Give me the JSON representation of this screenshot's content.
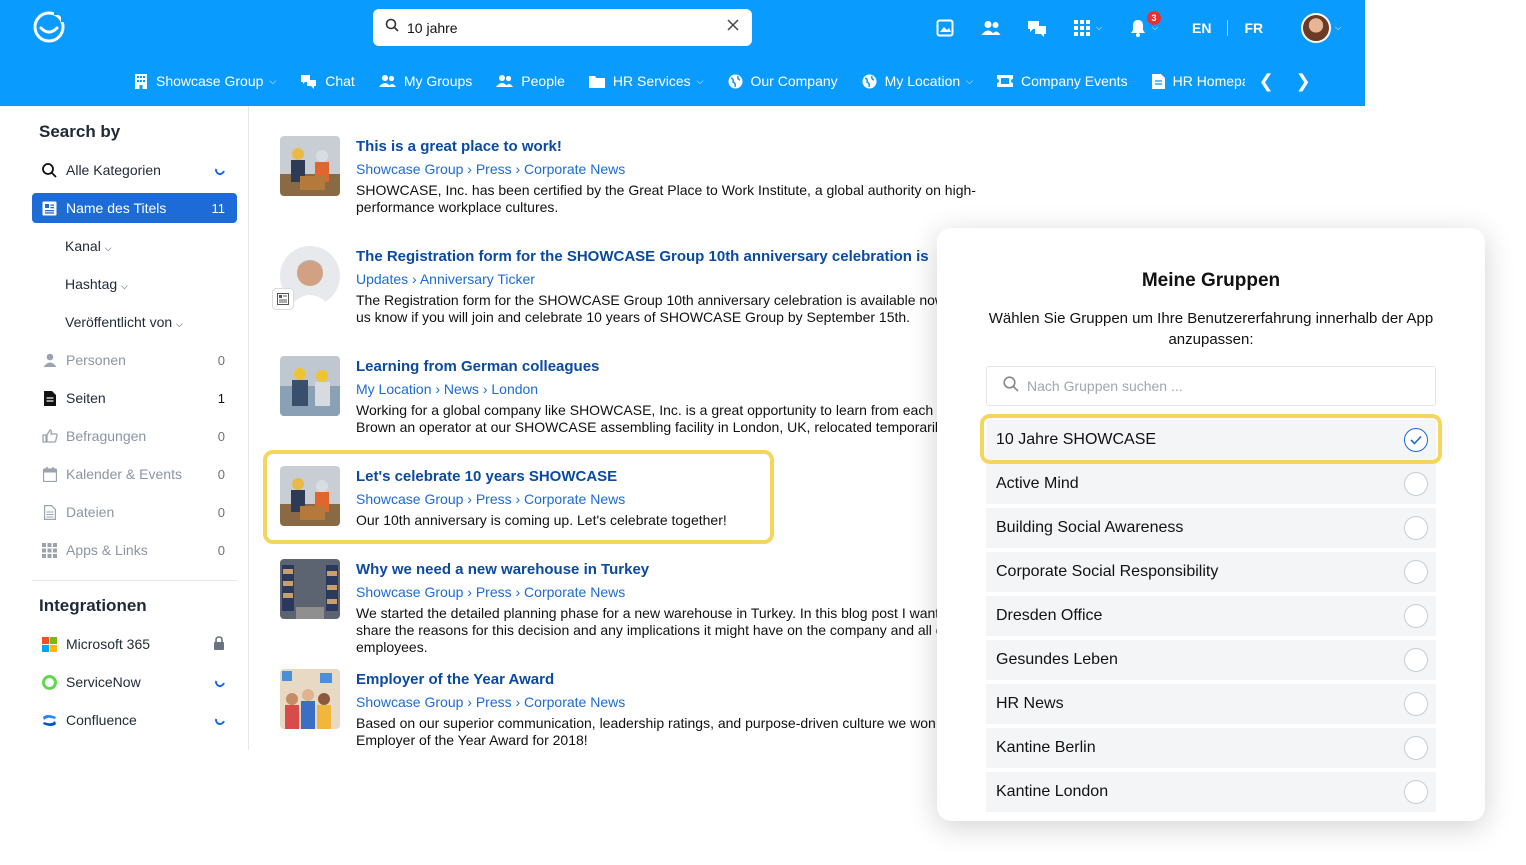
{
  "header": {
    "search_value": "10 jahre",
    "notification_count": "3",
    "languages": [
      "EN",
      "FR"
    ],
    "nav": [
      {
        "label": "Showcase Group",
        "icon": "building-icon",
        "dropdown": true
      },
      {
        "label": "Chat",
        "icon": "chat-icon",
        "dropdown": false
      },
      {
        "label": "My Groups",
        "icon": "users-icon",
        "dropdown": false
      },
      {
        "label": "People",
        "icon": "people-icon",
        "dropdown": false
      },
      {
        "label": "HR Services",
        "icon": "folder-icon",
        "dropdown": true
      },
      {
        "label": "Our Company",
        "icon": "globe-icon",
        "dropdown": false
      },
      {
        "label": "My Location",
        "icon": "globe-icon",
        "dropdown": true
      },
      {
        "label": "Company Events",
        "icon": "ticket-icon",
        "dropdown": false
      },
      {
        "label": "HR Homepage",
        "icon": "page-icon",
        "dropdown": false
      }
    ]
  },
  "sidebar": {
    "search_by_heading": "Search by",
    "categories": [
      {
        "label": "Alle Kategorien",
        "count": ""
      },
      {
        "label": "Name des Titels",
        "count": "11"
      }
    ],
    "filters": [
      "Kanal",
      "Hashtag",
      "Veröffentlicht von"
    ],
    "types": [
      {
        "label": "Personen",
        "count": "0"
      },
      {
        "label": "Seiten",
        "count": "1"
      },
      {
        "label": "Befragungen",
        "count": "0"
      },
      {
        "label": "Kalender & Events",
        "count": "0"
      },
      {
        "label": "Dateien",
        "count": "0"
      },
      {
        "label": "Apps & Links",
        "count": "0"
      }
    ],
    "integrations_heading": "Integrationen",
    "integrations": [
      {
        "label": "Microsoft 365"
      },
      {
        "label": "ServiceNow"
      },
      {
        "label": "Confluence"
      }
    ]
  },
  "results": [
    {
      "title": "This is a great place to work!",
      "crumb": "Showcase Group › Press › Corporate News",
      "snippet": "SHOWCASE, Inc. has been certified by the Great Place to Work Institute, a global authority on high-performance workplace cultures."
    },
    {
      "title": "The Registration form for the SHOWCASE Group 10th anniversary celebration is",
      "crumb": "Updates › Anniversary Ticker",
      "snippet": "The Registration form for the SHOWCASE Group 10th anniversary celebration is available now. Let us know if you will join and celebrate 10 years of SHOWCASE Group by September 15th."
    },
    {
      "title": "Learning from German colleagues",
      "crumb": "My Location › News › London",
      "snippet": "Working for a  global company like SHOWCASE, Inc. is a great opportunity to learn from each other. Brown an operator at our SHOWCASE assembling facility in London, UK, relocated temporarily"
    },
    {
      "title": "Let's celebrate 10 years SHOWCASE",
      "crumb": "Showcase Group › Press › Corporate News",
      "snippet": "Our 10th anniversary is coming up. Let's celebrate together!"
    },
    {
      "title": "Why we need a new warehouse in Turkey",
      "crumb": "Showcase Group › Press › Corporate News",
      "snippet": "We started the detailed planning phase for a new warehouse in Turkey. In this blog post I want to share the reasons for this decision and any implications it might have on the company and all our employees."
    },
    {
      "title": "Employer of the Year Award",
      "crumb": "Showcase Group › Press › Corporate News",
      "snippet": "Based on our superior communication, leadership ratings, and purpose-driven culture we won the Employer of the Year Award for 2018!"
    }
  ],
  "modal": {
    "title": "Meine Gruppen",
    "subtitle": "Wählen Sie Gruppen um Ihre Benutzererfahrung innerhalb der App anzupassen:",
    "search_placeholder": "Nach Gruppen suchen ...",
    "groups": [
      {
        "label": "10 Jahre SHOWCASE",
        "selected": true
      },
      {
        "label": "Active Mind",
        "selected": false
      },
      {
        "label": "Building Social Awareness",
        "selected": false
      },
      {
        "label": "Corporate Social Responsibility",
        "selected": false
      },
      {
        "label": "Dresden Office",
        "selected": false
      },
      {
        "label": "Gesundes Leben",
        "selected": false
      },
      {
        "label": "HR News",
        "selected": false
      },
      {
        "label": "Kantine Berlin",
        "selected": false
      },
      {
        "label": "Kantine London",
        "selected": false
      }
    ]
  },
  "colors": {
    "brand": "#0a9bff",
    "active": "#1c6bd6",
    "link": "#0b4aa1",
    "highlight": "#f5d55b"
  }
}
